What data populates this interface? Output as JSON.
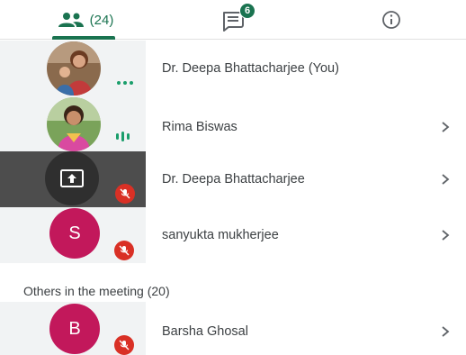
{
  "tabs": {
    "people_count": "(24)",
    "chat_badge": "6"
  },
  "participants": [
    {
      "name": "Dr. Deepa Bhattacharjee (You)",
      "status": "speaking-dots",
      "chevron": false
    },
    {
      "name": "Rima Biswas",
      "status": "audio-bars",
      "chevron": true
    },
    {
      "name": "Dr. Deepa Bhattacharjee",
      "status": "presenting-muted",
      "chevron": true
    },
    {
      "name": "sanyukta mukherjee",
      "initial": "S",
      "status": "muted",
      "chevron": true
    }
  ],
  "others_section": {
    "title": "Others in the meeting (20)",
    "participants": [
      {
        "name": "Barsha Ghosal",
        "initial": "B",
        "status": "muted",
        "chevron": true
      }
    ]
  },
  "colors": {
    "accent": "#1a7350",
    "mute_red": "#d93025",
    "avatar_pink": "#c2185b",
    "presenting_tile": "#4d4d4d",
    "tile_bg": "#f1f3f4"
  }
}
